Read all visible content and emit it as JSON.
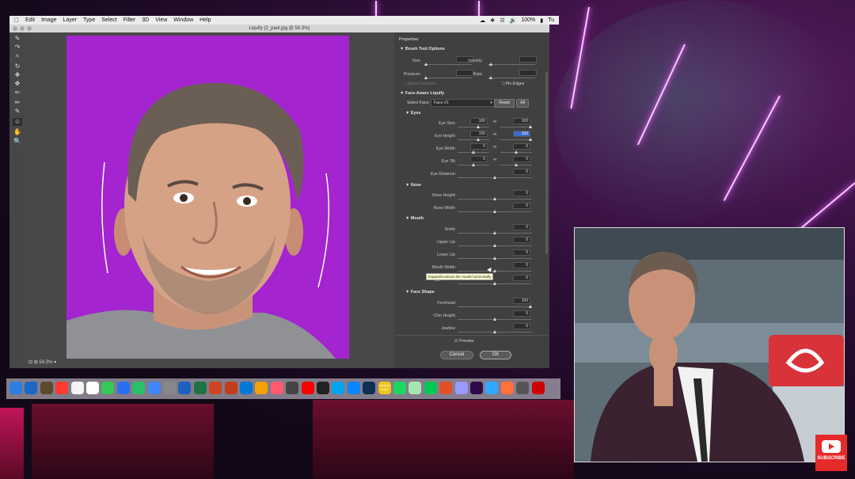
{
  "menubar": {
    "items": [
      "Edit",
      "Image",
      "Layer",
      "Type",
      "Select",
      "Filter",
      "3D",
      "View",
      "Window",
      "Help"
    ],
    "battery": "100%",
    "clock": "Tu"
  },
  "window": {
    "title": "Liquify (2_paul.jpg @ 58.3%)",
    "zoom": "58.3%"
  },
  "panel": {
    "title": "Properties",
    "brush": {
      "header": "Brush Tool Options",
      "size": "Size:",
      "density": "Density:",
      "pressure": "Pressure:",
      "rate": "Rate:",
      "stylus": "Stylus Pressure",
      "pin": "Pin Edges"
    },
    "face": {
      "header": "Face-Aware Liquify",
      "select_face_label": "Select Face:",
      "select_face_value": "Face #1",
      "reset": "Reset",
      "all": "All"
    },
    "eyes": {
      "header": "Eyes",
      "eye_size": "Eye Size:",
      "eye_size_l": "100",
      "eye_size_r": "100",
      "eye_height": "Eye Height:",
      "eye_height_l": "100",
      "eye_height_r": "100",
      "eye_width": "Eye Width:",
      "eye_width_l": "0",
      "eye_width_r": "0",
      "eye_tilt": "Eye Tilt:",
      "eye_tilt_l": "0",
      "eye_tilt_r": "0",
      "eye_distance": "Eye Distance:",
      "eye_distance_v": "0"
    },
    "nose": {
      "header": "Nose",
      "nose_height": "Nose Height:",
      "nose_height_v": "0",
      "nose_width": "Nose Width:",
      "nose_width_v": "0"
    },
    "mouth": {
      "header": "Mouth",
      "smile": "Smile:",
      "smile_v": "0",
      "upper_lip": "Upper Lip:",
      "upper_lip_v": "0",
      "lower_lip": "Lower Lip:",
      "lower_lip_v": "0",
      "mouth_width": "Mouth Width:",
      "mouth_width_v": "0",
      "mouth_height": "Mo",
      "mouth_height_v": "0"
    },
    "tooltip": "Expand/contract the mouth horizontally",
    "shape": {
      "header": "Face Shape",
      "forehead": "Forehead:",
      "forehead_v": "100",
      "chin_height": "Chin Height:",
      "chin_height_v": "0",
      "jawline": "Jawline:",
      "jawline_v": "0"
    },
    "preview": "Preview",
    "cancel": "Cancel",
    "ok": "OK"
  },
  "dock": {
    "app_labels": {
      "music": "amazon music"
    },
    "colors": [
      "#2a7fe0",
      "#1a66c9",
      "#5d4a2b",
      "#ff3b30",
      "#f4f4f4",
      "#ffffff",
      "#34c759",
      "#2b6ff0",
      "#2bbf6a",
      "#4285f4",
      "#888888",
      "#1f5fbf",
      "#207245",
      "#d04423",
      "#c43e1c",
      "#0078d4",
      "#f4a100",
      "#ff5a6e",
      "#444444",
      "#ff0000",
      "#222222",
      "#00a4ef",
      "#0a84ff",
      "#0f2f57",
      "#f0c419",
      "#1ed760",
      "#a7e5b0",
      "#00c853",
      "#e34f26",
      "#9999ff",
      "#2d0a4a",
      "#31a8ff",
      "#ff7139",
      "#555555",
      "#cc0000"
    ]
  },
  "webcam": {
    "subscribe": "SUBSCRIBE"
  }
}
